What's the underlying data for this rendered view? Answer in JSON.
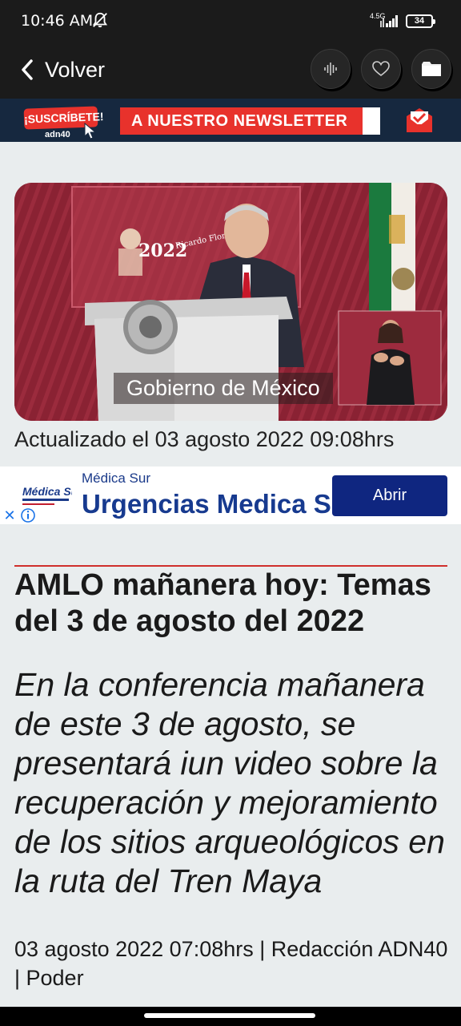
{
  "status_bar": {
    "time": "10:46 AM",
    "network": "4.5G",
    "battery": "34"
  },
  "app_bar": {
    "back_label": "Volver"
  },
  "newsletter": {
    "subscribe": "¡SUSCRÍBETE!",
    "brand": "adn40",
    "banner": "A NUESTRO NEWSLETTER"
  },
  "hero": {
    "caption": "Gobierno de México",
    "lectern_text_1": "2022",
    "lectern_text_2": "Ricardo Flores Magón"
  },
  "article": {
    "updated": "Actualizado el 03 agosto 2022 09:08hrs",
    "title": "AMLO mañanera hoy: Temas del 3 de agosto del 2022",
    "lead": "En la conferencia mañanera de este 3 de agosto, se presentará iun video sobre la recuperación y mejoramiento de los sitios arqueológicos en la ruta del Tren Maya",
    "meta": "03 agosto 2022 07:08hrs | Redacción ADN40 | Poder"
  },
  "ad": {
    "logo_text": "Médica Sur",
    "advertiser": "Médica Sur",
    "headline": "Urgencias Medica Sur",
    "cta": "Abrir",
    "close": "✕"
  },
  "colors": {
    "topbar": "#1b1b1b",
    "newsletter_bg": "#16283f",
    "accent_red": "#e8322c",
    "ad_blue": "#0f2680",
    "page_bg": "#e9edee"
  },
  "icons": [
    "bell-off-icon",
    "signal-icon",
    "battery-icon",
    "chevron-left-icon",
    "audio-waveform-icon",
    "heart-icon",
    "folder-icon",
    "mail-icon",
    "cursor-icon",
    "ad-info-icon",
    "close-icon"
  ]
}
